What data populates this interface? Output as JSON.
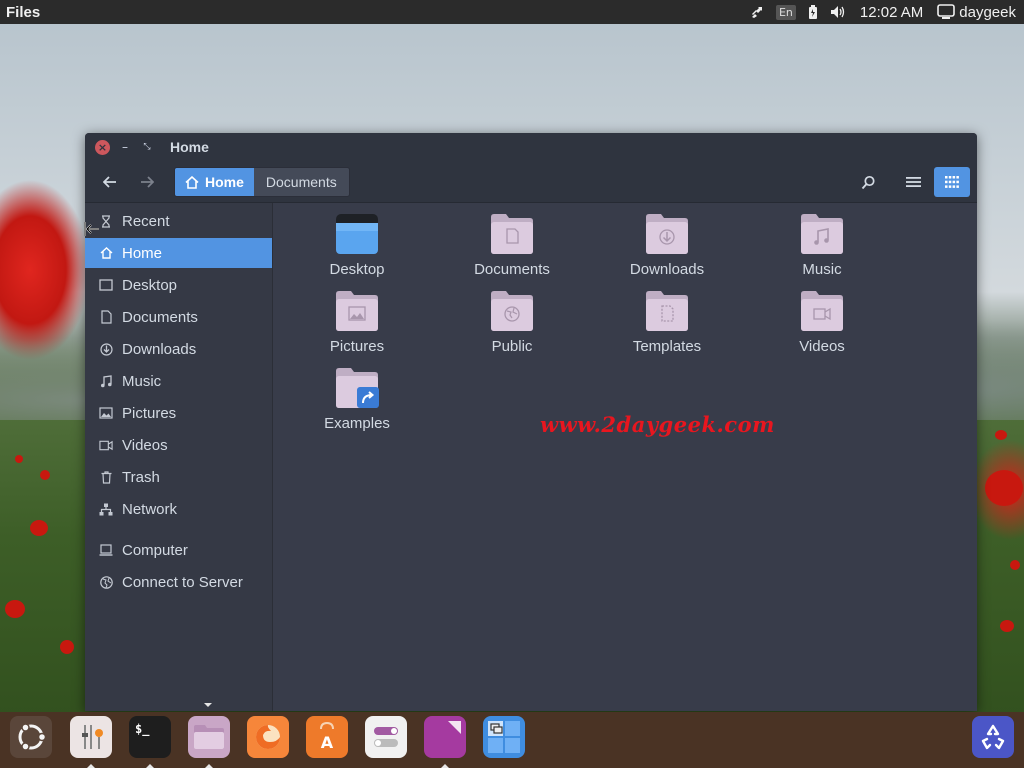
{
  "top_panel": {
    "app_title": "Files",
    "keyboard_layout": "En",
    "clock": "12:02 AM",
    "user": "daygeek"
  },
  "window": {
    "title": "Home",
    "pathbar": {
      "home": "Home",
      "documents": "Documents"
    }
  },
  "sidebar": {
    "items": [
      {
        "label": "Recent",
        "icon": "clock-icon"
      },
      {
        "label": "Home",
        "icon": "home-icon",
        "active": true
      },
      {
        "label": "Desktop",
        "icon": "desktop-icon"
      },
      {
        "label": "Documents",
        "icon": "document-icon"
      },
      {
        "label": "Downloads",
        "icon": "download-icon"
      },
      {
        "label": "Music",
        "icon": "music-icon"
      },
      {
        "label": "Pictures",
        "icon": "picture-icon"
      },
      {
        "label": "Videos",
        "icon": "video-icon"
      },
      {
        "label": "Trash",
        "icon": "trash-icon"
      },
      {
        "label": "Network",
        "icon": "network-icon"
      },
      {
        "label": "Computer",
        "icon": "computer-icon"
      },
      {
        "label": "Connect to Server",
        "icon": "globe-icon"
      }
    ]
  },
  "folders": [
    {
      "label": "Desktop",
      "icon": "desktop-folder-icon"
    },
    {
      "label": "Documents",
      "icon": "documents-folder-icon"
    },
    {
      "label": "Downloads",
      "icon": "downloads-folder-icon"
    },
    {
      "label": "Music",
      "icon": "music-folder-icon"
    },
    {
      "label": "Pictures",
      "icon": "pictures-folder-icon"
    },
    {
      "label": "Public",
      "icon": "public-folder-icon"
    },
    {
      "label": "Templates",
      "icon": "templates-folder-icon"
    },
    {
      "label": "Videos",
      "icon": "videos-folder-icon"
    },
    {
      "label": "Examples",
      "icon": "examples-link-folder-icon"
    }
  ],
  "watermark": "www.2daygeek.com",
  "dock": {
    "apps": [
      "ubuntu-logo-icon",
      "system-settings-icon",
      "terminal-icon",
      "files-icon",
      "firefox-icon",
      "software-center-icon",
      "tweak-tool-icon",
      "office-icon",
      "workspace-switcher-icon",
      "trash-dock-icon"
    ]
  },
  "colors": {
    "accent": "#5294e2",
    "window_bg": "#383c4a",
    "titlebar_bg": "#2f343f",
    "sidebar_bg": "#353945",
    "folder_color": "#d9c8dc",
    "close_button": "#cc575d",
    "dock_bg": "#4a3324",
    "watermark": "#e8161f"
  }
}
